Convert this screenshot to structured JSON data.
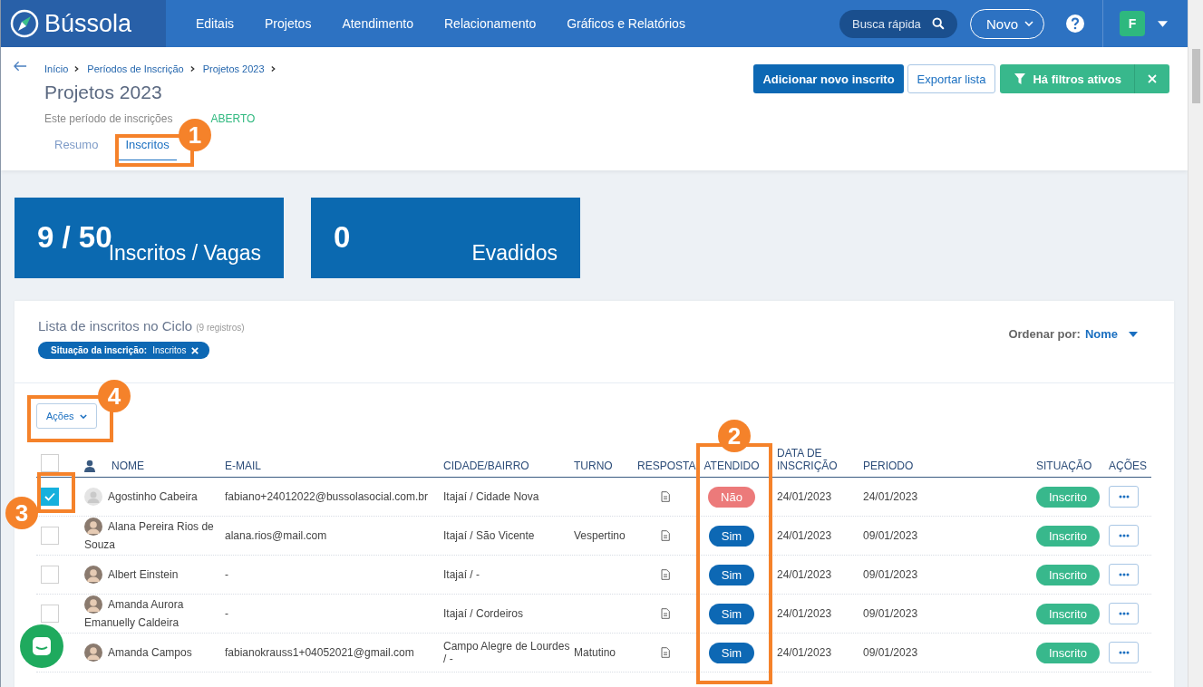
{
  "navbar": {
    "logo": "Bússola",
    "menu": [
      "Editais",
      "Projetos",
      "Atendimento",
      "Relacionamento",
      "Gráficos e Relatórios"
    ],
    "search": {
      "placeholder": "Busca rápida"
    },
    "new_button": "Novo",
    "user_initial": "F"
  },
  "breadcrumbs": [
    "Início",
    "Períodos de Inscrição",
    "Projetos 2023"
  ],
  "page_title": "Projetos 2023",
  "status_line": {
    "text": "Este período de inscrições",
    "status": "ABERTO"
  },
  "tabs": [
    {
      "label": "Resumo",
      "selected": false
    },
    {
      "label": "Inscritos",
      "selected": true
    }
  ],
  "header_buttons": {
    "add": "Adicionar novo inscrito",
    "export": "Exportar lista",
    "filters": "Há filtros ativos"
  },
  "stats": [
    {
      "value": "9 / 50",
      "label": "Inscritos / Vagas"
    },
    {
      "value": "0",
      "label": "Evadidos"
    }
  ],
  "list": {
    "title": "Lista de inscritos no Ciclo",
    "count": "(9 registros)",
    "filter_chip": {
      "name": "Situação da inscrição:",
      "value": "Inscritos"
    },
    "sort_label": "Ordenar por:",
    "sort_value": "Nome",
    "actions_button": "Ações"
  },
  "table": {
    "all_selected": false,
    "columns": [
      "NOME",
      "E-MAIL",
      "CIDADE/BAIRRO",
      "TURNO",
      "RESPOSTA",
      "ATENDIDO",
      "DATA DE INSCRIÇÃO",
      "PERIODO",
      "SITUAÇÃO",
      "AÇÕES"
    ],
    "rows": [
      {
        "selected": true,
        "has_photo": false,
        "name": "Agostinho Cabeira",
        "email": "fabiano+24012022@bussolasocial.com.br",
        "city": "Itajaí / Cidade Nova",
        "shift": "",
        "attended": false,
        "attended_text": "Não",
        "date": "24/01/2023",
        "period": "24/01/2023",
        "status": "Inscrito"
      },
      {
        "selected": false,
        "has_photo": true,
        "name": "Alana Pereira Rios de Souza",
        "email": "alana.rios@mail.com",
        "city": "Itajaí / São Vicente",
        "shift": "Vespertino",
        "attended": true,
        "attended_text": "Sim",
        "date": "24/01/2023",
        "period": "09/01/2023",
        "status": "Inscrito"
      },
      {
        "selected": false,
        "has_photo": true,
        "name": "Albert Einstein",
        "email": "-",
        "city": "Itajaí / -",
        "shift": "",
        "attended": true,
        "attended_text": "Sim",
        "date": "24/01/2023",
        "period": "09/01/2023",
        "status": "Inscrito"
      },
      {
        "selected": false,
        "has_photo": true,
        "name": "Amanda Aurora Emanuelly Caldeira",
        "email": "-",
        "city": "Itajaí / Cordeiros",
        "shift": "",
        "attended": true,
        "attended_text": "Sim",
        "date": "24/01/2023",
        "period": "09/01/2023",
        "status": "Inscrito"
      },
      {
        "has_photo": true,
        "name": "Amanda Campos",
        "email": "fabianokrauss1+04052021@gmail.com",
        "city": "Campo Alegre de Lourdes / -",
        "shift": "Matutino",
        "attended": true,
        "attended_text": "Sim",
        "date": "24/01/2023",
        "period": "09/01/2023",
        "status": "Inscrito"
      }
    ]
  },
  "callouts": [
    "1",
    "2",
    "3",
    "4"
  ]
}
